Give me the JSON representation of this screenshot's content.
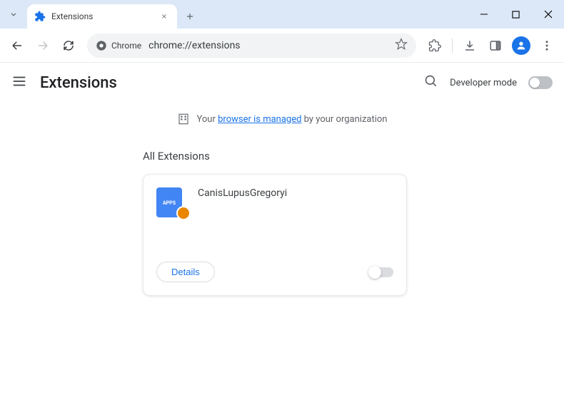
{
  "tab": {
    "title": "Extensions"
  },
  "omnibox": {
    "chip": "Chrome",
    "url": "chrome://extensions"
  },
  "page": {
    "title": "Extensions",
    "dev_mode_label": "Developer mode"
  },
  "managed": {
    "prefix": "Your ",
    "link": "browser is managed",
    "suffix": " by your organization"
  },
  "section": {
    "all_extensions": "All Extensions"
  },
  "extension": {
    "name": "CanisLupusGregoryi",
    "details_label": "Details",
    "icon_text": "APPS"
  }
}
